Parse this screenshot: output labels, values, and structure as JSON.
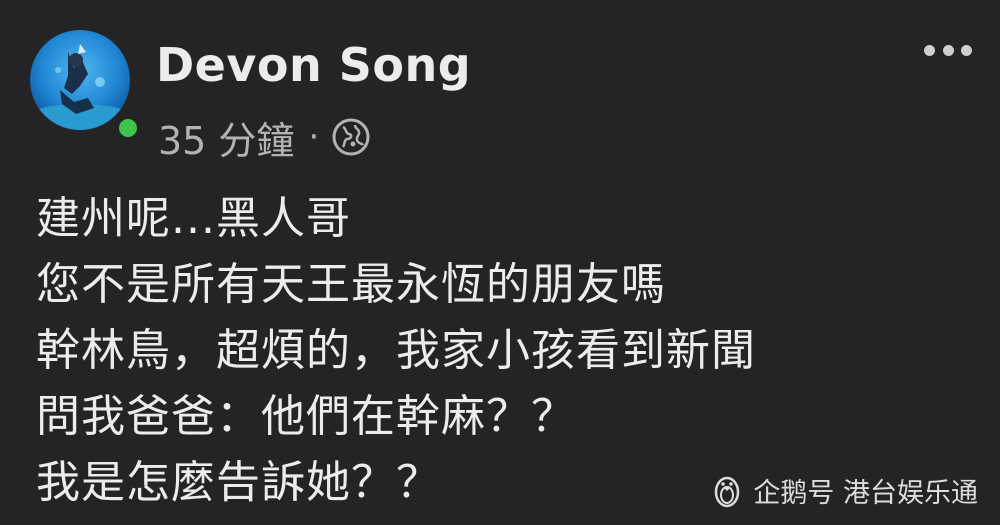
{
  "post": {
    "author_name": "Devon Song",
    "timestamp": "35 分鐘",
    "separator": "·",
    "privacy_icon": "globe-icon",
    "more_icon": "more-options-icon",
    "lines": [
      "建州呢...黑人哥",
      "您不是所有天王最永恆的朋友嗎",
      "幹林鳥，超煩的，我家小孩看到新聞",
      "問我爸爸：他們在幹麻？？",
      "我是怎麼告訴她？？"
    ]
  },
  "watermark": {
    "text": "企鹅号 港台娱乐通",
    "icon": "penguin-icon"
  },
  "colors": {
    "background": "#242426",
    "online_status": "#3ec24a",
    "text": "#ececec",
    "secondary_text": "#b3b3b5"
  }
}
